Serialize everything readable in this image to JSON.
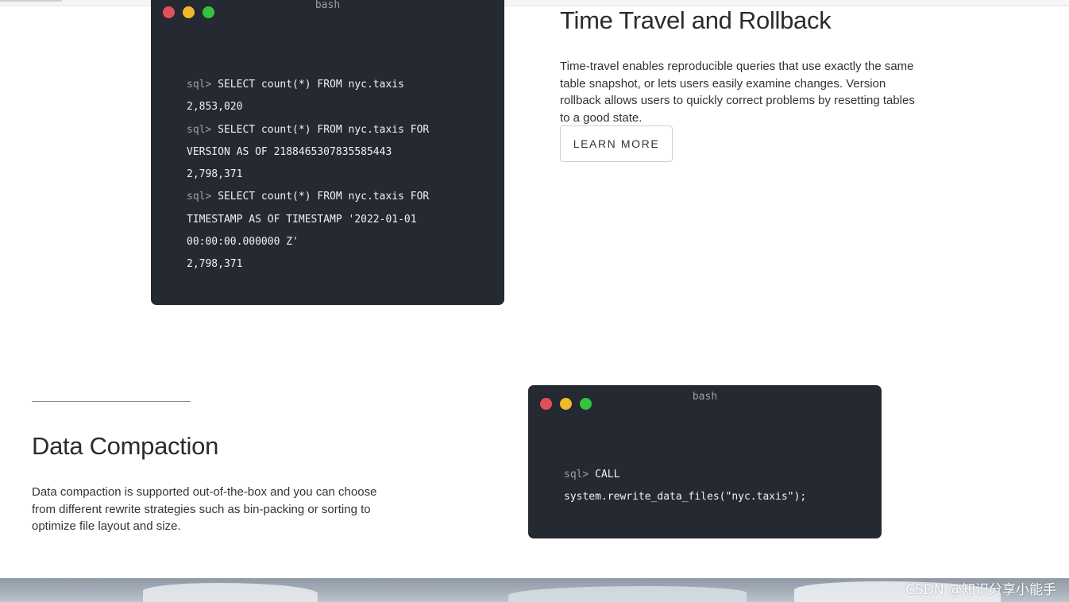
{
  "terminal_top": {
    "title": "bash",
    "lines": [
      {
        "prompt": "sql>",
        "text": "SELECT count(*) FROM nyc.taxis"
      },
      {
        "prompt": "",
        "text": "2,853,020"
      },
      {
        "prompt": "sql>",
        "text": "SELECT count(*) FROM nyc.taxis FOR"
      },
      {
        "prompt": "",
        "text": "VERSION AS OF 2188465307835585443"
      },
      {
        "prompt": "",
        "text": "2,798,371"
      },
      {
        "prompt": "sql>",
        "text": "SELECT count(*) FROM nyc.taxis FOR"
      },
      {
        "prompt": "",
        "text": "TIMESTAMP AS OF TIMESTAMP '2022-01-01"
      },
      {
        "prompt": "",
        "text": "00:00:00.000000 Z'"
      },
      {
        "prompt": "",
        "text": "2,798,371"
      }
    ]
  },
  "time_travel": {
    "heading": "Time Travel and Rollback",
    "description": "Time-travel enables reproducible queries that use exactly the same table snapshot, or lets users easily examine changes. Version rollback allows users to quickly correct problems by resetting tables to a good state.",
    "button_label": "LEARN MORE"
  },
  "data_compaction": {
    "heading": "Data Compaction",
    "description": "Data compaction is supported out-of-the-box and you can choose from different rewrite strategies such as bin-packing or sorting to optimize file layout and size."
  },
  "terminal_bottom": {
    "title": "bash",
    "lines": [
      {
        "prompt": "sql>",
        "text": "CALL"
      },
      {
        "prompt": "",
        "text": "system.rewrite_data_files(\"nyc.taxis\");"
      }
    ]
  },
  "watermark": "CSDN @知识分享小能手",
  "colors": {
    "terminal_bg": "#252931",
    "dot_red": "#e0505c",
    "dot_yellow": "#f1b928",
    "dot_green": "#36c33c"
  }
}
